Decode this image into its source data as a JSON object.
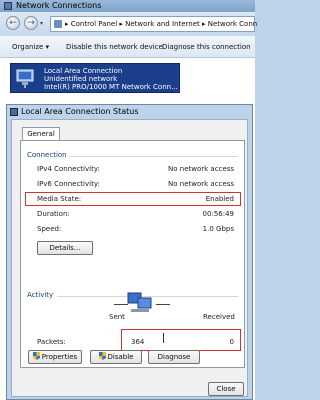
{
  "window": {
    "title": "Network Connections"
  },
  "address": {
    "path": "▸ Control Panel ▸ Network and Internet ▸ Network Conn"
  },
  "commandbar": {
    "organize": "Organize ▾",
    "disable": "Disable this network device",
    "diagnose": "Diagnose this connection"
  },
  "connection_tile": {
    "name": "Local Area Connection",
    "status": "Unidentified network",
    "adapter": "Intel(R) PRO/1000 MT Network Conn..."
  },
  "dialog": {
    "title": "Local Area Connection Status",
    "tab_general": "General",
    "connection_group": "Connection",
    "rows": [
      {
        "label": "IPv4 Connectivity:",
        "value": "No network access"
      },
      {
        "label": "IPv6 Connectivity:",
        "value": "No network access"
      },
      {
        "label": "Media State:",
        "value": "Enabled"
      },
      {
        "label": "Duration:",
        "value": "00:56:49"
      },
      {
        "label": "Speed:",
        "value": "1.0 Gbps"
      }
    ],
    "details_button": "Details...",
    "activity_group": "Activity",
    "sent_label": "Sent",
    "received_label": "Received",
    "packets_label": "Packets:",
    "packets_sent": "364",
    "packets_received": "0",
    "properties_button": "Properties",
    "disable_button": "Disable",
    "diagnose_button": "Diagnose",
    "close_button": "Close"
  },
  "colors": {
    "tile_bg": "#1c3f8c",
    "highlight": "#d63030",
    "group_text": "#1a3c7a",
    "window_frame": "#bcd3ea"
  }
}
